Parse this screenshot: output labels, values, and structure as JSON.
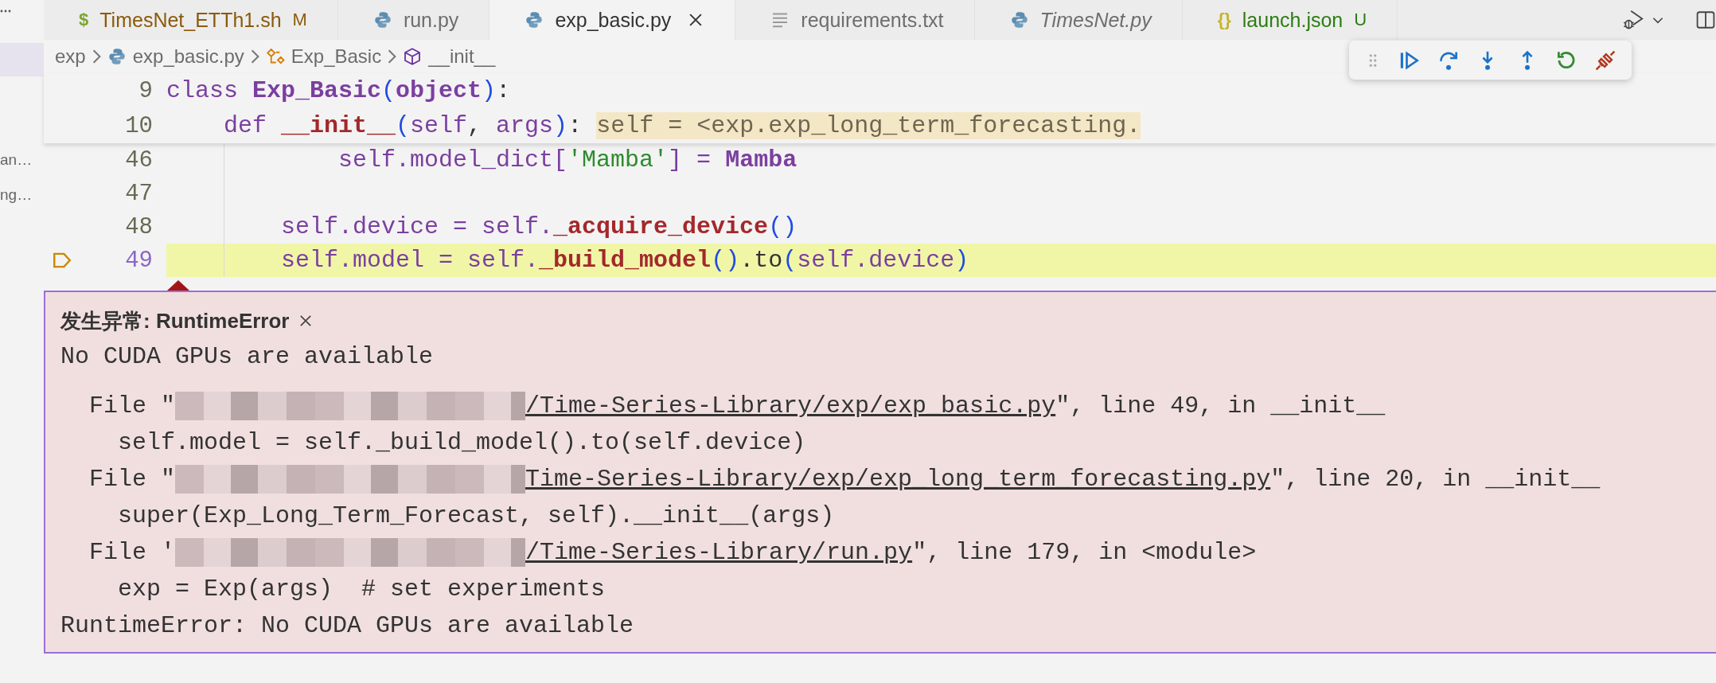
{
  "sidebar": {
    "items": [
      {
        "label": "an…"
      },
      {
        "label": "ng…"
      }
    ]
  },
  "tabs": [
    {
      "label": "TimesNet_ETTh1.sh",
      "kind": "shell",
      "glyph": "$",
      "badge": "M",
      "color": "#8b5a0c",
      "selected": false,
      "preview": false
    },
    {
      "label": "run.py",
      "kind": "python",
      "selected": false,
      "preview": false
    },
    {
      "label": "exp_basic.py",
      "kind": "python",
      "selected": true,
      "preview": false
    },
    {
      "label": "requirements.txt",
      "kind": "text",
      "selected": false,
      "preview": false
    },
    {
      "label": "TimesNet.py",
      "kind": "python",
      "selected": false,
      "preview": true
    },
    {
      "label": "launch.json",
      "kind": "json",
      "glyph": "{}",
      "badge": "U",
      "color": "#2e7d14",
      "selected": false,
      "preview": false
    }
  ],
  "breadcrumb": [
    {
      "label": "exp",
      "kind": "folder"
    },
    {
      "label": "exp_basic.py",
      "kind": "python"
    },
    {
      "label": "Exp_Basic",
      "kind": "class"
    },
    {
      "label": "__init__",
      "kind": "method"
    }
  ],
  "debug_toolbar": [
    {
      "kind": "grip"
    },
    {
      "kind": "continue"
    },
    {
      "kind": "step-over"
    },
    {
      "kind": "step-into"
    },
    {
      "kind": "step-out"
    },
    {
      "kind": "restart"
    },
    {
      "kind": "disconnect"
    }
  ],
  "sticky_lines": [
    {
      "number": "9",
      "kind": "class",
      "tokens": [
        {
          "kind": "keyword",
          "text": "class "
        },
        {
          "kind": "class",
          "text": "Exp_Basic"
        },
        {
          "kind": "bracket",
          "text": "("
        },
        {
          "kind": "class",
          "text": "object"
        },
        {
          "kind": "bracket",
          "text": ")"
        },
        {
          "kind": "plain",
          "text": ":"
        }
      ]
    },
    {
      "number": "10",
      "kind": "method",
      "tokens": [
        {
          "kind": "keyword",
          "text": "def "
        },
        {
          "kind": "function",
          "text": "__init__"
        },
        {
          "kind": "bracket",
          "text": "("
        },
        {
          "kind": "variable",
          "text": "self"
        },
        {
          "kind": "plain",
          "text": ", "
        },
        {
          "kind": "variable",
          "text": "args"
        },
        {
          "kind": "bracket",
          "text": ")"
        },
        {
          "kind": "plain",
          "text": ": "
        }
      ],
      "inline_value": "self = <exp.exp_long_term_forecasting."
    }
  ],
  "code_lines": [
    {
      "number": "46",
      "kind": "nested",
      "current": false,
      "tokens": [
        {
          "kind": "variable",
          "text": "self.model_dict["
        },
        {
          "kind": "string",
          "text": "'Mamba'"
        },
        {
          "kind": "variable",
          "text": "] = "
        },
        {
          "kind": "class",
          "text": "Mamba"
        }
      ]
    },
    {
      "number": "47",
      "kind": "blank",
      "current": false
    },
    {
      "number": "48",
      "kind": "statement",
      "current": false,
      "tokens": [
        {
          "kind": "variable",
          "text": "self.device = self."
        },
        {
          "kind": "function",
          "text": "_acquire_device"
        },
        {
          "kind": "bracket",
          "text": "()"
        }
      ]
    },
    {
      "number": "49",
      "kind": "statement",
      "current": true,
      "tokens": [
        {
          "kind": "variable",
          "text": "self.model = self."
        },
        {
          "kind": "function",
          "text": "_build_model"
        },
        {
          "kind": "bracket",
          "text": "()"
        },
        {
          "kind": "plain",
          "text": ".to"
        },
        {
          "kind": "bracket",
          "text": "("
        },
        {
          "kind": "variable",
          "text": "self.device"
        },
        {
          "kind": "bracket",
          "text": ")"
        }
      ]
    }
  ],
  "exception": {
    "title": "发生异常: RuntimeError",
    "message": "No CUDA GPUs are available",
    "traceback": [
      {
        "kind": "frame",
        "prefix": "File \"",
        "redacted": true,
        "link": "/Time-Series-Library/exp/exp_basic.py",
        "suffix": "\", line 49, in __init__"
      },
      {
        "kind": "code",
        "text": "self.model = self._build_model().to(self.device)"
      },
      {
        "kind": "frame",
        "prefix": "File \"",
        "redacted": true,
        "link": "Time-Series-Library/exp/exp_long_term_forecasting.py",
        "suffix": "\", line 20, in __init__"
      },
      {
        "kind": "code",
        "text": "super(Exp_Long_Term_Forecast, self).__init__(args)"
      },
      {
        "kind": "frame",
        "prefix": "File '",
        "redacted": true,
        "link": "/Time-Series-Library/run.py",
        "suffix": "\", line 179, in <module>"
      },
      {
        "kind": "code",
        "text": "exp = Exp(args)  # set experiments"
      }
    ],
    "final": "RuntimeError: No CUDA GPUs are available"
  }
}
